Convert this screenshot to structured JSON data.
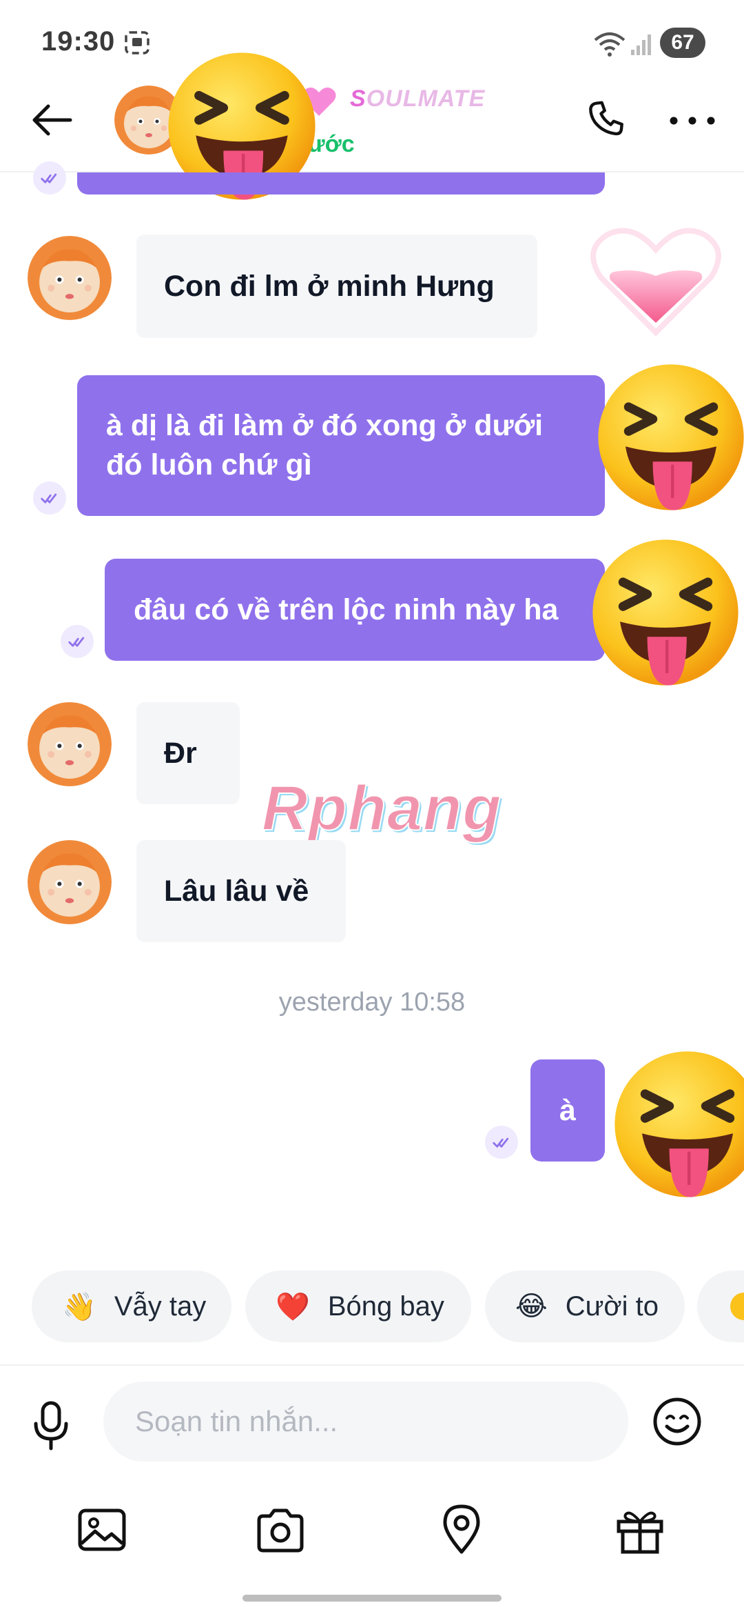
{
  "status_bar": {
    "time": "19:30",
    "battery": "67"
  },
  "header": {
    "brand": "SOULMATE",
    "brand_first": "S",
    "brand_rest": "OULMATE",
    "subtitle_partial": "ước"
  },
  "messages": [
    {
      "id": "m1",
      "side": "in",
      "text": "Con đi lm ở minh Hưng"
    },
    {
      "id": "m2",
      "side": "out",
      "text": "à dị là đi làm ở đó xong ở dưới đó luôn chứ gì"
    },
    {
      "id": "m3",
      "side": "out",
      "text": "đâu có về trên lộc ninh này ha"
    },
    {
      "id": "m4",
      "side": "in",
      "text": "Đr"
    },
    {
      "id": "m5",
      "side": "in",
      "text": "Lâu lâu về"
    },
    {
      "id": "m6",
      "side": "out",
      "text": "à"
    }
  ],
  "time_divider": "yesterday 10:58",
  "watermark": "Rphang",
  "quick_replies": [
    {
      "emoji": "👋",
      "label": "Vẫy tay"
    },
    {
      "emoji": "❤️",
      "label": "Bóng bay"
    },
    {
      "emoji": "😂",
      "label": "Cười to"
    }
  ],
  "composer": {
    "placeholder": "Soạn tin nhắn..."
  },
  "colors": {
    "outgoing_bubble": "#8f71ec",
    "incoming_bubble": "#f5f6f8",
    "online_status": "#18c06b"
  }
}
